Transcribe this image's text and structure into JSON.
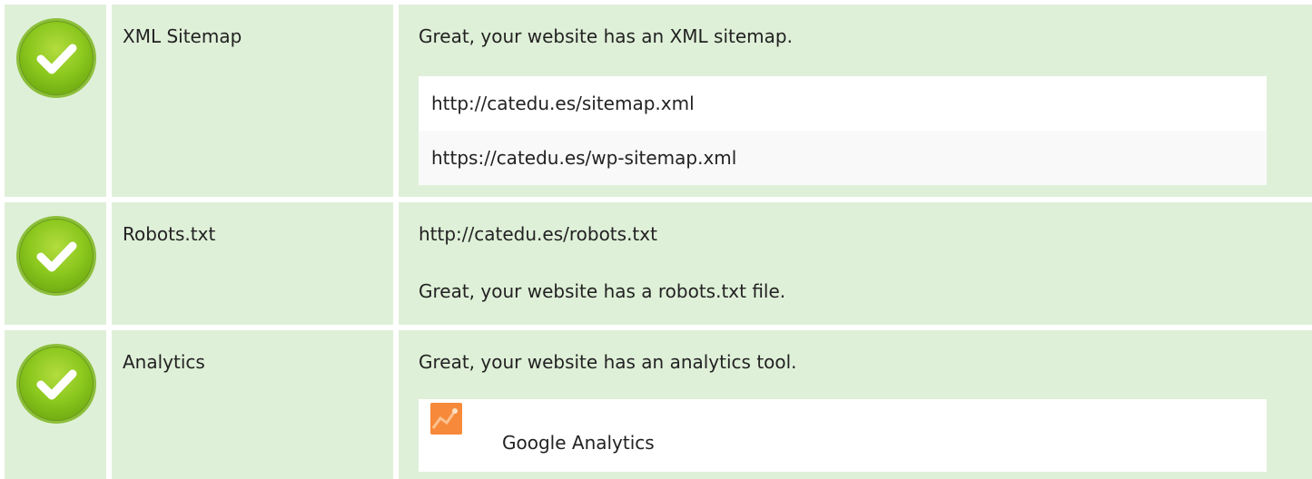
{
  "checks": [
    {
      "label": "XML Sitemap",
      "message": "Great, your website has an XML sitemap.",
      "items": [
        "http://catedu.es/sitemap.xml",
        "https://catedu.es/wp-sitemap.xml"
      ]
    },
    {
      "label": "Robots.txt",
      "url": "http://catedu.es/robots.txt",
      "message": "Great, your website has a robots.txt file."
    },
    {
      "label": "Analytics",
      "message": "Great, your website has an analytics tool.",
      "tool": "Google Analytics"
    }
  ],
  "colors": {
    "pass_background": "#dff0d8",
    "check_green": "#8cc81e",
    "analytics_orange": "#f7893a"
  },
  "icons": [
    "check-circle-icon",
    "google-analytics-icon"
  ]
}
